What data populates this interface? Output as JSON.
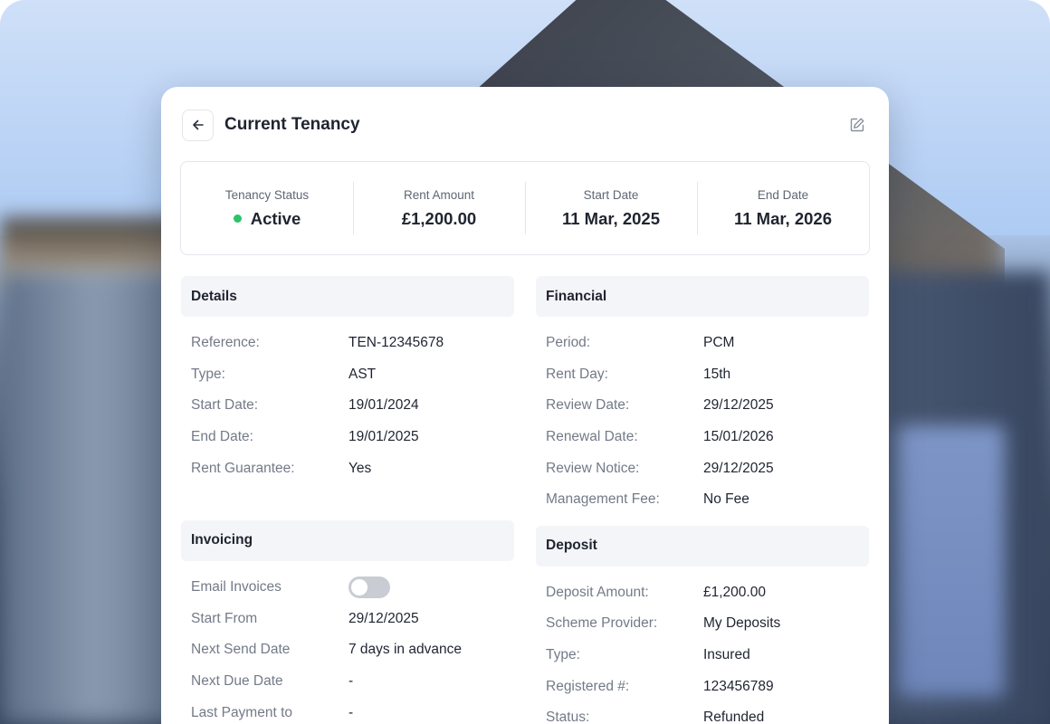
{
  "header": {
    "title": "Current Tenancy"
  },
  "summary": {
    "status_label": "Tenancy Status",
    "status_value": "Active",
    "status_color": "#2dc26b",
    "rent_label": "Rent Amount",
    "rent_value": "£1,200.00",
    "start_label": "Start Date",
    "start_value": "11 Mar, 2025",
    "end_label": "End Date",
    "end_value": "11 Mar, 2026"
  },
  "details": {
    "title": "Details",
    "rows": [
      {
        "k": "Reference:",
        "v": "TEN-12345678"
      },
      {
        "k": "Type:",
        "v": "AST"
      },
      {
        "k": "Start Date:",
        "v": "19/01/2024"
      },
      {
        "k": "End Date:",
        "v": "19/01/2025"
      },
      {
        "k": "Rent Guarantee:",
        "v": "Yes"
      }
    ]
  },
  "invoicing": {
    "title": "Invoicing",
    "email_label": "Email Invoices",
    "email_enabled": false,
    "rows": [
      {
        "k": "Start From",
        "v": "29/12/2025"
      },
      {
        "k": "Next Send Date",
        "v": "7 days in advance"
      },
      {
        "k": "Next Due Date",
        "v": "-"
      },
      {
        "k": "Last Payment to",
        "v": "-"
      }
    ]
  },
  "financial": {
    "title": "Financial",
    "rows": [
      {
        "k": "Period:",
        "v": "PCM"
      },
      {
        "k": "Rent Day:",
        "v": "15th"
      },
      {
        "k": "Review Date:",
        "v": "29/12/2025"
      },
      {
        "k": "Renewal Date:",
        "v": "15/01/2026"
      },
      {
        "k": "Review Notice:",
        "v": "29/12/2025"
      },
      {
        "k": "Management Fee:",
        "v": "No Fee"
      }
    ]
  },
  "deposit": {
    "title": "Deposit",
    "rows": [
      {
        "k": "Deposit Amount:",
        "v": "£1,200.00"
      },
      {
        "k": "Scheme Provider:",
        "v": "My Deposits"
      },
      {
        "k": "Type:",
        "v": "Insured"
      },
      {
        "k": "Registered #:",
        "v": "123456789"
      },
      {
        "k": "Status:",
        "v": "Refunded"
      }
    ]
  },
  "icons": {
    "back": "arrow-left-icon",
    "edit": "edit-icon"
  }
}
